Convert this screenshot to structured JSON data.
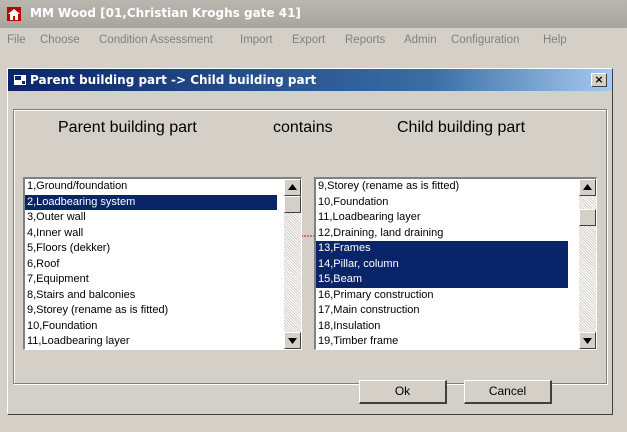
{
  "app": {
    "title": "MM Wood  [01,Christian Kroghs gate 41]"
  },
  "menu": [
    "File",
    "Choose",
    "Condition Assessment",
    "Import",
    "Export",
    "Reports",
    "Admin",
    "Configuration",
    "Help"
  ],
  "dialog": {
    "title": "Parent building part -> Child building part",
    "close_label": "×",
    "header_left": "Parent building part",
    "header_middle": "contains",
    "header_right": "Child building part"
  },
  "parent_list": {
    "items": [
      "1,Ground/foundation",
      "2,Loadbearing system",
      "3,Outer wall",
      "4,Inner wall",
      "5,Floors (dekker)",
      "6,Roof",
      "7,Equipment",
      "8,Stairs and balconies",
      "9,Storey (rename as is fitted)",
      "10,Foundation",
      "11,Loadbearing layer"
    ],
    "selected": [
      "2,Loadbearing system"
    ]
  },
  "child_list": {
    "items": [
      "9,Storey (rename as is fitted)",
      "10,Foundation",
      "11,Loadbearing layer",
      "12,Draining, land draining",
      "13,Frames",
      "14,Pillar, column",
      "15,Beam",
      "16,Primary construction",
      "17,Main construction",
      "18,Insulation",
      "19,Timber frame"
    ],
    "selected": [
      "13,Frames",
      "14,Pillar, column",
      "15,Beam"
    ]
  },
  "buttons": {
    "ok_label": "Ok",
    "cancel_label": "Cancel"
  },
  "colors": {
    "selection": "#0a246a",
    "arrow": "#e00000",
    "dialog_title": "#0a246a"
  }
}
